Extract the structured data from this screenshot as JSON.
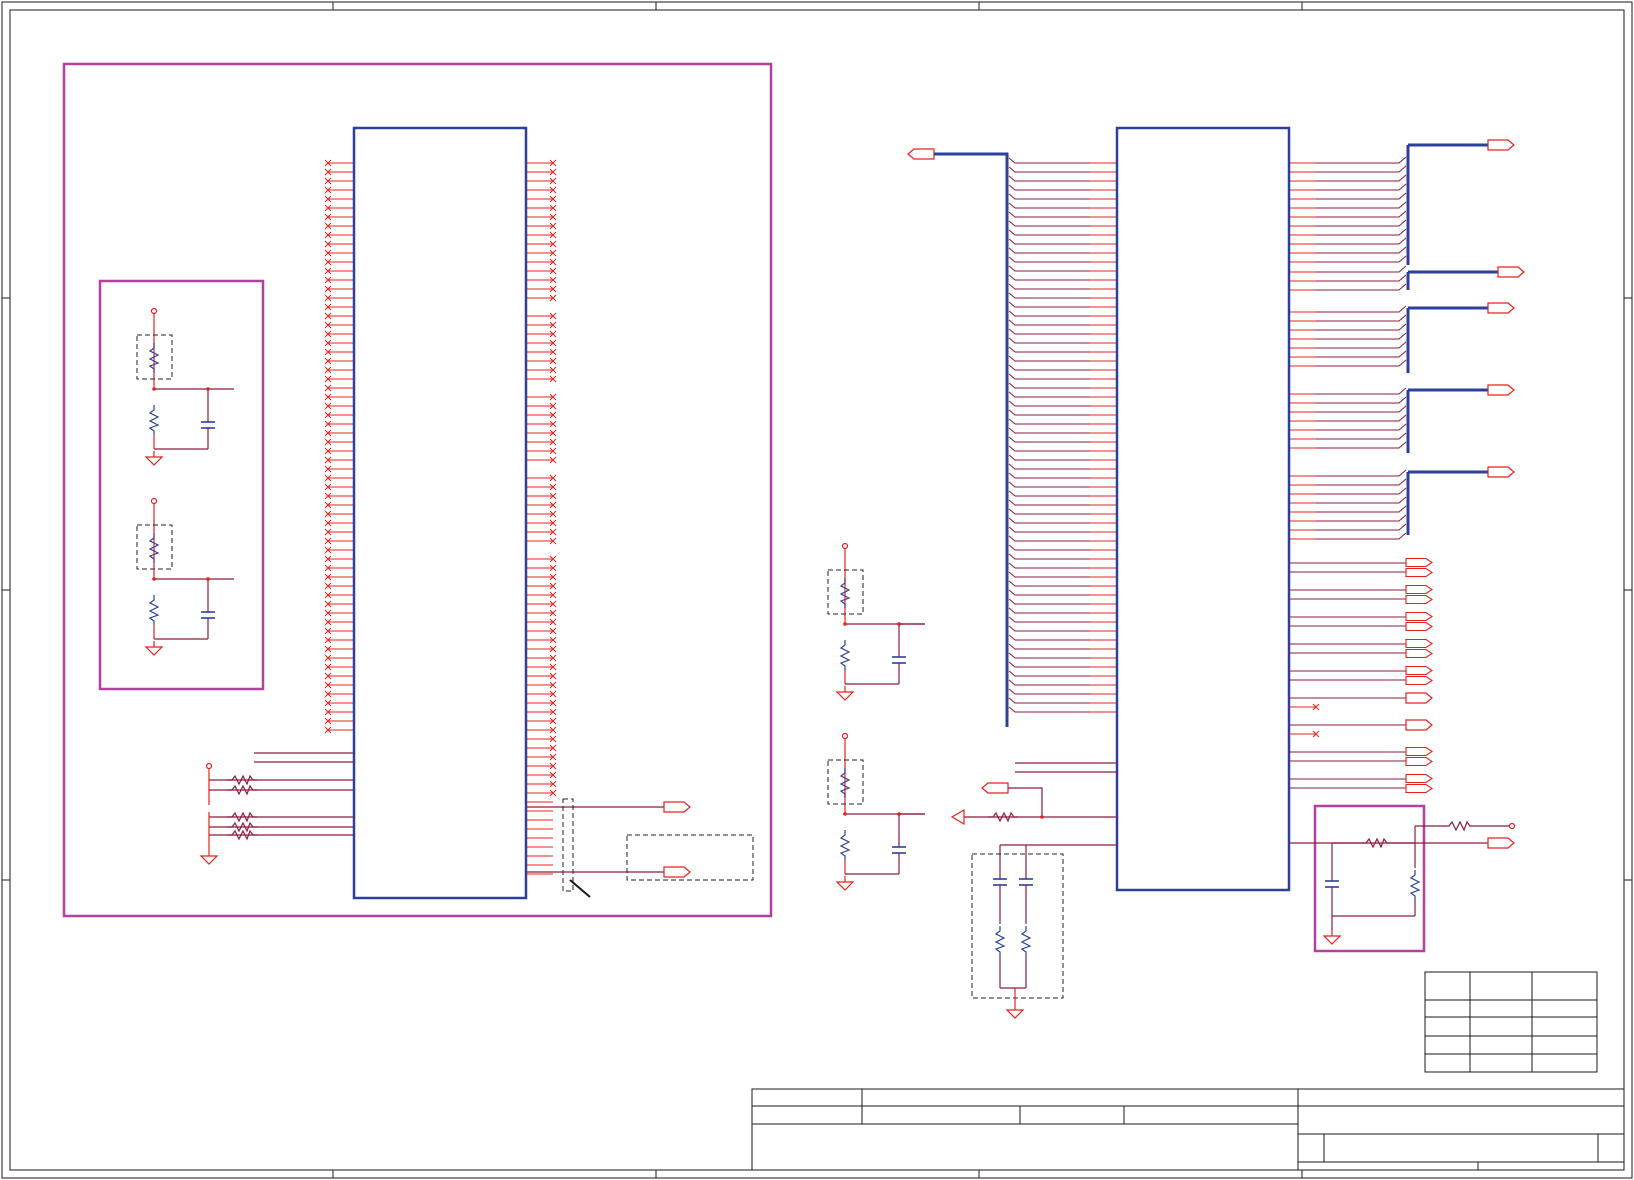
{
  "title": "",
  "colors": {
    "background": "#ffffff",
    "sheet_frame": "#1a1a1a",
    "net_wire": "#e8201d",
    "bus_wire": "#2b3f9b",
    "signal_trace": "#8a1c3c",
    "block_border": "#b2419e",
    "chip_outline": "#2b3f9b",
    "passive_body": "#2b3f9b",
    "dashed_group": "#222222"
  },
  "legend": [],
  "rev_table": {
    "rows": 4,
    "columns": 3
  },
  "title_block": {
    "fields": []
  }
}
